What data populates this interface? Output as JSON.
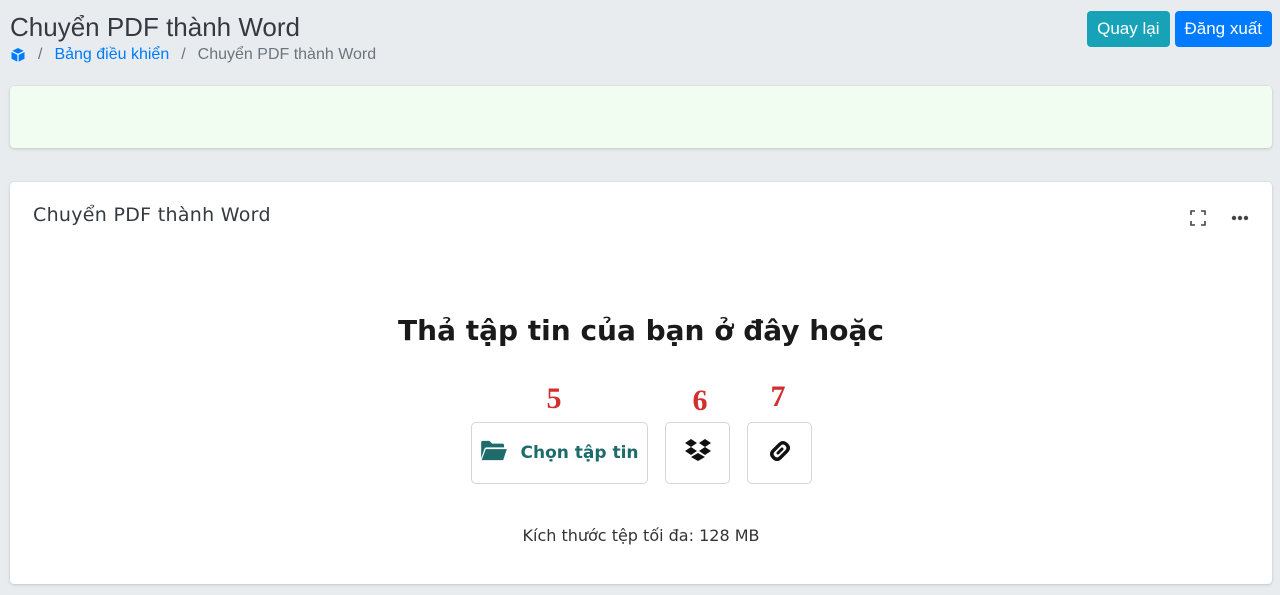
{
  "header": {
    "title": "Chuyển PDF thành Word",
    "back_label": "Quay lại",
    "logout_label": "Đăng xuất"
  },
  "breadcrumb": {
    "home_icon": "cube-icon",
    "link": "Bảng điều khiển",
    "current": "Chuyển PDF thành Word",
    "separator": "/"
  },
  "card": {
    "title": "Chuyển PDF thành Word",
    "tools": [
      "expand-icon",
      "more-icon"
    ]
  },
  "upload": {
    "heading": "Thả tập tin của bạn ở đây hoặc",
    "choose_file_label": "Chọn tập tin",
    "max_size_text": "Kích thước tệp tối đa: 128 MB",
    "annotations": [
      "5",
      "6",
      "7"
    ]
  },
  "colors": {
    "accent_info": "#17a2b8",
    "accent_primary": "#007bff",
    "upload_text": "#1e6b6b",
    "annotation_red": "#d32f2f",
    "alert_bg": "#f0fdf0"
  }
}
